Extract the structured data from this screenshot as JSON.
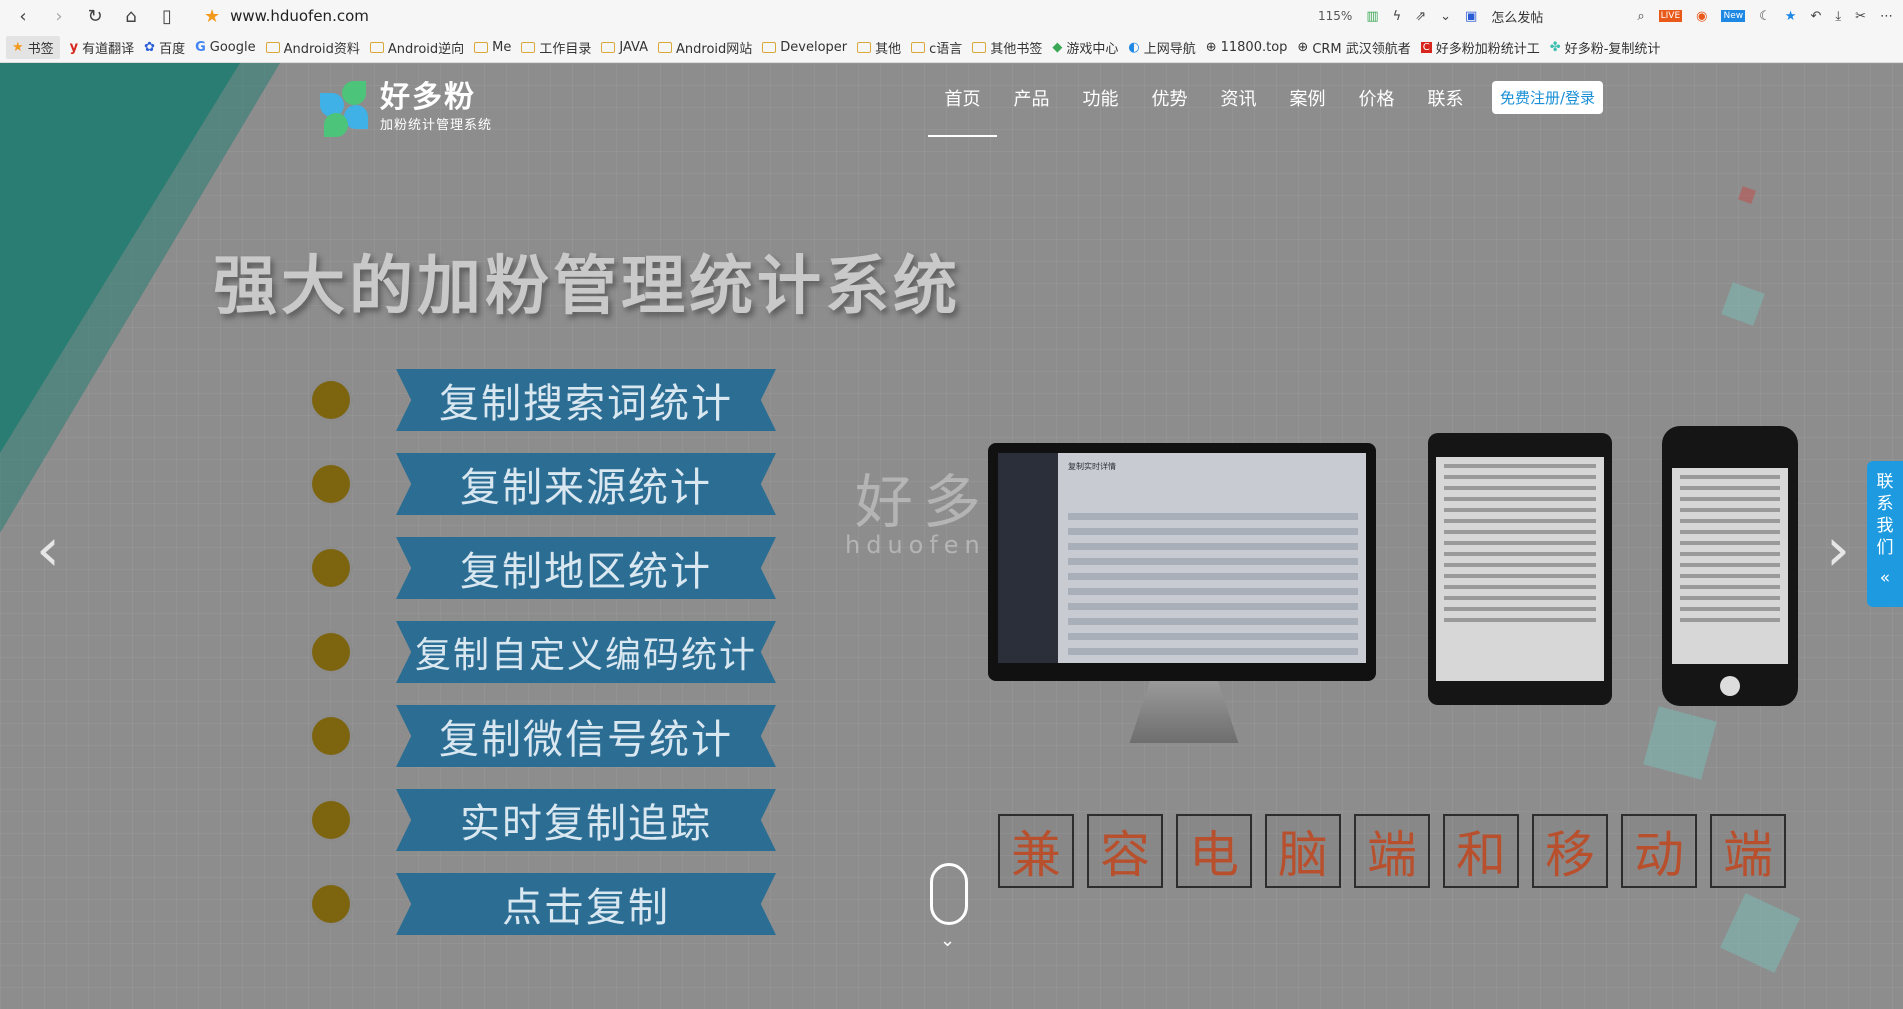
{
  "browser": {
    "url": "www.hduofen.com",
    "zoom": "115%",
    "search_hint": "怎么发帖",
    "bookmarks": [
      "书签",
      "有道翻译",
      "百度",
      "Google",
      "Android资料",
      "Android逆向",
      "Me",
      "工作目录",
      "JAVA",
      "Android网站",
      "Developer",
      "其他",
      "c语言",
      "其他书签",
      "游戏中心",
      "上网导航",
      "11800.top",
      "CRM 武汉领航者",
      "好多粉加粉统计工",
      "好多粉-复制统计"
    ]
  },
  "site": {
    "logo_title": "好多粉",
    "logo_subtitle": "加粉统计管理系统",
    "nav": [
      "首页",
      "产品",
      "功能",
      "优势",
      "资讯",
      "案例",
      "价格",
      "联系"
    ],
    "cta": "免费注册/登录",
    "headline": "强大的加粉管理统计系统",
    "features": [
      "复制搜索词统计",
      "复制来源统计",
      "复制地区统计",
      "复制自定义编码统计",
      "复制微信号统计",
      "实时复制追踪",
      "点击复制"
    ],
    "watermark_cn": "好多粉",
    "watermark_en": "hduofen.com",
    "compat_chars": [
      "兼",
      "容",
      "电",
      "脑",
      "端",
      "和",
      "移",
      "动",
      "端"
    ],
    "monitor_header": "复制实时详情",
    "contact_tab": [
      "联",
      "系",
      "我",
      "们"
    ]
  },
  "colors": {
    "ribbon": "#2c6d93",
    "accent_cta": "#1a8fd6",
    "teal": "#2a7d72",
    "compat_text": "#b8502e"
  }
}
